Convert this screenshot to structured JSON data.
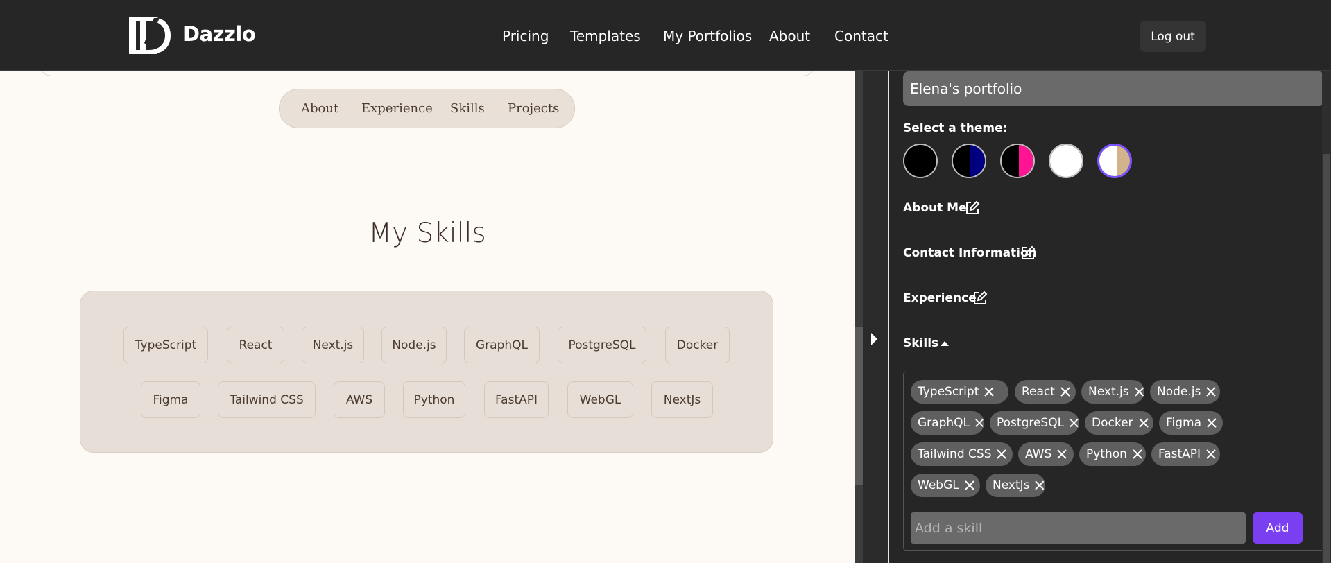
{
  "brand": {
    "name": "Dazzlo"
  },
  "nav": {
    "items": [
      "Pricing",
      "Templates",
      "My Portfolios",
      "About",
      "Contact"
    ],
    "logout_label": "Log out"
  },
  "preview": {
    "section_nav": [
      "About",
      "Experience",
      "Skills",
      "Projects"
    ],
    "skills_title": "My Skills",
    "skills": [
      "TypeScript",
      "React",
      "Next.js",
      "Node.js",
      "GraphQL",
      "PostgreSQL",
      "Docker",
      "Figma",
      "Tailwind CSS",
      "AWS",
      "Python",
      "FastAPI",
      "WebGL",
      "NextJs"
    ]
  },
  "panel": {
    "portfolio_name": "Elena's portfolio",
    "theme_label": "Select a theme:",
    "themes": [
      {
        "name": "black",
        "colors": [
          "#000000",
          "#000000"
        ]
      },
      {
        "name": "black-navy",
        "colors": [
          "#000000",
          "#000080"
        ]
      },
      {
        "name": "black-pink",
        "colors": [
          "#000000",
          "#ff1493"
        ]
      },
      {
        "name": "white",
        "colors": [
          "#ffffff",
          "#ffffff"
        ]
      },
      {
        "name": "white-tan",
        "colors": [
          "#ffffff",
          "#d2b48c"
        ],
        "selected": true
      }
    ],
    "sections": {
      "about": "About Me",
      "contact": "Contact Information",
      "experience": "Experience",
      "skills": "Skills"
    },
    "skill_tags": [
      "TypeScript",
      "React",
      "Next.js",
      "Node.js",
      "GraphQL",
      "PostgreSQL",
      "Docker",
      "Figma",
      "Tailwind CSS",
      "AWS",
      "Python",
      "FastAPI",
      "WebGL",
      "NextJs"
    ],
    "add_placeholder": "Add a skill",
    "add_label": "Add"
  },
  "colors": {
    "accent": "#7b3ff2",
    "topbar": "#262626",
    "preview_bg": "#fdf9f4",
    "chip_bg": "#e7dfd7"
  }
}
